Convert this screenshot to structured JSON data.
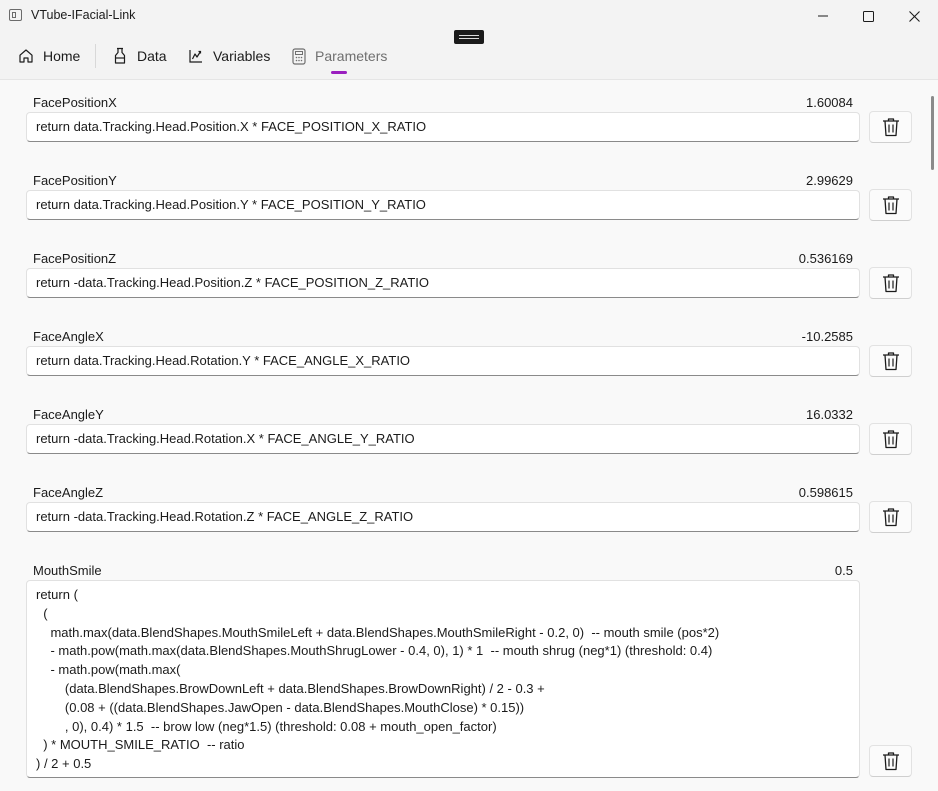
{
  "window": {
    "title": "VTube-IFacial-Link"
  },
  "nav": {
    "tabs": [
      {
        "label": "Home",
        "icon": "home-icon"
      },
      {
        "label": "Data",
        "icon": "flask-icon"
      },
      {
        "label": "Variables",
        "icon": "function-icon"
      },
      {
        "label": "Parameters",
        "icon": "calculator-icon",
        "selected": true
      }
    ],
    "accent_color": "#9a1fbf"
  },
  "parameters": [
    {
      "name": "FacePositionX",
      "value": "1.60084",
      "expression": "return data.Tracking.Head.Position.X * FACE_POSITION_X_RATIO"
    },
    {
      "name": "FacePositionY",
      "value": "2.99629",
      "expression": "return data.Tracking.Head.Position.Y * FACE_POSITION_Y_RATIO"
    },
    {
      "name": "FacePositionZ",
      "value": "0.536169",
      "expression": "return -data.Tracking.Head.Position.Z * FACE_POSITION_Z_RATIO"
    },
    {
      "name": "FaceAngleX",
      "value": "-10.2585",
      "expression": "return data.Tracking.Head.Rotation.Y * FACE_ANGLE_X_RATIO"
    },
    {
      "name": "FaceAngleY",
      "value": "16.0332",
      "expression": "return -data.Tracking.Head.Rotation.X * FACE_ANGLE_Y_RATIO"
    },
    {
      "name": "FaceAngleZ",
      "value": "0.598615",
      "expression": "return -data.Tracking.Head.Rotation.Z * FACE_ANGLE_Z_RATIO"
    },
    {
      "name": "MouthSmile",
      "value": "0.5",
      "expression": "return (\n  (\n    math.max(data.BlendShapes.MouthSmileLeft + data.BlendShapes.MouthSmileRight - 0.2, 0)  -- mouth smile (pos*2)\n    - math.pow(math.max(data.BlendShapes.MouthShrugLower - 0.4, 0), 1) * 1  -- mouth shrug (neg*1) (threshold: 0.4)\n    - math.pow(math.max(\n        (data.BlendShapes.BrowDownLeft + data.BlendShapes.BrowDownRight) / 2 - 0.3 +\n        (0.08 + ((data.BlendShapes.JawOpen - data.BlendShapes.MouthClose) * 0.15))\n        , 0), 0.4) * 1.5  -- brow low (neg*1.5) (threshold: 0.08 + mouth_open_factor)\n  ) * MOUTH_SMILE_RATIO  -- ratio\n) / 2 + 0.5"
    }
  ]
}
